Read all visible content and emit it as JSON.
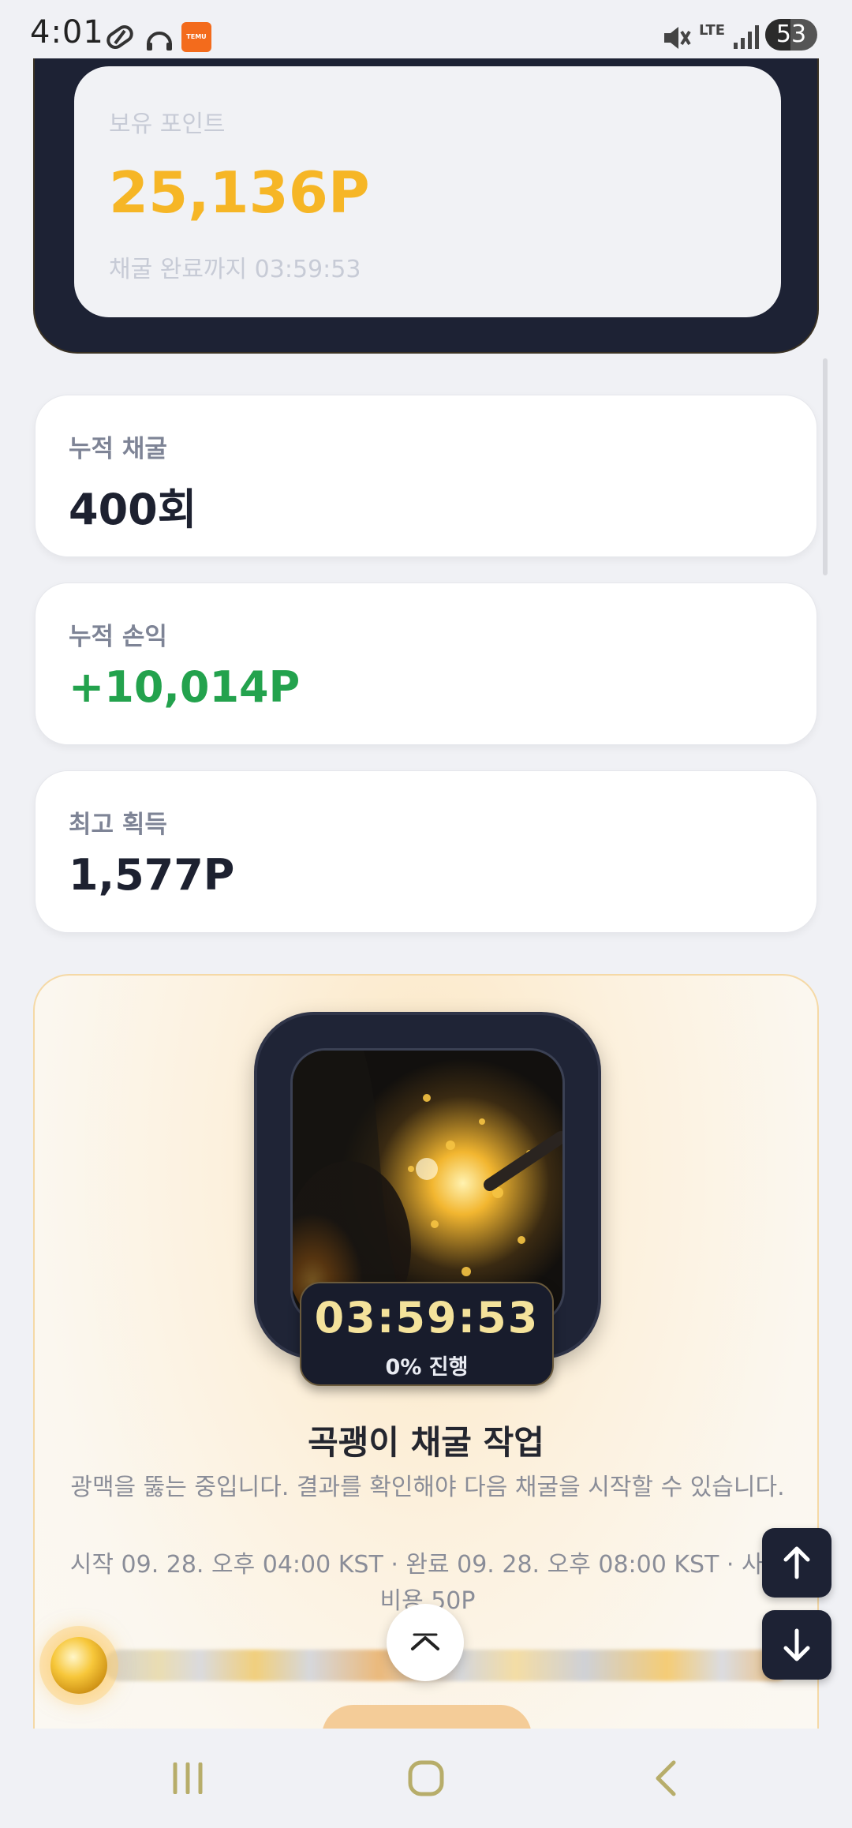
{
  "status_bar": {
    "time": "4:01",
    "temu_label": "TEMU",
    "network": "LTE",
    "battery": "53"
  },
  "points_card": {
    "label": "보유 포인트",
    "value": "25,136P",
    "subtitle": "채굴 완료까지 03:59:53"
  },
  "stats": [
    {
      "label": "누적 채굴",
      "value": "400회"
    },
    {
      "label": "누적 손익",
      "value": "+10,014P",
      "color": "#23a24d"
    },
    {
      "label": "최고 획득",
      "value": "1,577P"
    }
  ],
  "mining": {
    "timer": "03:59:53",
    "progress_text": "0% 진행",
    "progress": 0,
    "title": "곡괭이 채굴 작업",
    "description": "광맥을 뚫는 중입니다. 결과를 확인해야 다음 채굴을 시작할 수 있습니다.",
    "info": "시작 09. 28. 오후 04:00 KST · 완료 09. 28. 오후 08:00 KST · 사용 비용 50P"
  },
  "colors": {
    "accent": "#f6b626",
    "dark": "#1d2234",
    "profit": "#23a24d"
  },
  "icons": {
    "scroll_top": "chevron-up-icon",
    "page_up": "arrow-up-icon",
    "page_down": "arrow-down-icon",
    "nav_recents": "recents-icon",
    "nav_home": "home-icon",
    "nav_back": "back-icon"
  }
}
